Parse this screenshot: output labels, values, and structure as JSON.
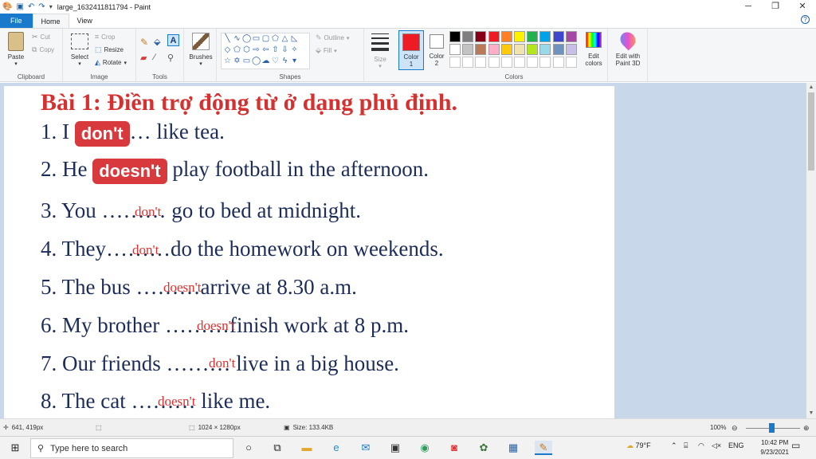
{
  "window": {
    "title": "large_1632411811794 - Paint",
    "qa_icons": [
      "paint-icon",
      "save-icon",
      "undo-icon",
      "redo-icon",
      "customize-icon"
    ]
  },
  "tabs": [
    {
      "label": "File"
    },
    {
      "label": "Home"
    },
    {
      "label": "View"
    }
  ],
  "ribbon": {
    "clipboard": {
      "name": "Clipboard",
      "paste": "Paste",
      "cut": "Cut",
      "copy": "Copy"
    },
    "image": {
      "name": "Image",
      "select": "Select",
      "crop": "Crop",
      "resize": "Resize",
      "rotate": "Rotate"
    },
    "tools": {
      "name": "Tools"
    },
    "brushes": {
      "label": "Brushes"
    },
    "shapes": {
      "name": "Shapes",
      "outline": "Outline",
      "fill": "Fill"
    },
    "size": {
      "label": "Size"
    },
    "color1": {
      "label": "Color\n1",
      "l1": "Color",
      "l2": "1",
      "value": "#ed1c24"
    },
    "color2": {
      "l1": "Color",
      "l2": "2",
      "value": "#ffffff"
    },
    "colors": {
      "name": "Colors",
      "row1": [
        "#000000",
        "#7f7f7f",
        "#880015",
        "#ed1c24",
        "#ff7f27",
        "#fff200",
        "#22b14c",
        "#00a2e8",
        "#3f48cc",
        "#a349a4"
      ],
      "row2": [
        "#ffffff",
        "#c3c3c3",
        "#b97a57",
        "#ffaec9",
        "#ffc90e",
        "#efe4b0",
        "#b5e61d",
        "#99d9ea",
        "#7092be",
        "#c8bfe7"
      ],
      "row3": [
        "#ffffff",
        "#ffffff",
        "#ffffff",
        "#ffffff",
        "#ffffff",
        "#ffffff",
        "#ffffff",
        "#ffffff",
        "#ffffff",
        "#ffffff"
      ]
    },
    "edit_colors": {
      "l1": "Edit",
      "l2": "colors"
    },
    "paint3d": {
      "l1": "Edit with",
      "l2": "Paint 3D"
    }
  },
  "document": {
    "title": "Bài 1: Điền trợ động từ ở dạng phủ định.",
    "lines": [
      {
        "pre": "1. I ",
        "highlight": "don't",
        "post": "… like tea."
      },
      {
        "pre": "2. He ",
        "highlight": "doesn't",
        "post": " play football in the afternoon."
      },
      {
        "text": "3. You ……… go to bed at midnight.",
        "answer": "don't"
      },
      {
        "text": "4. They………do the homework on weekends.",
        "answer": "don't"
      },
      {
        "text": "5. The bus ………arrive at 8.30 a.m.",
        "answer": "doesn't"
      },
      {
        "text": "6. My brother ………finish work at 8 p.m.",
        "answer": "doesn't"
      },
      {
        "text": "7. Our friends ……… live in a big house.",
        "answer": "don't"
      },
      {
        "text": "8. The cat ……… like me.",
        "answer": "doesn't"
      }
    ]
  },
  "status": {
    "cursor": "641, 419px",
    "dimensions": "1024 × 1280px",
    "size": "Size: 133.4KB",
    "zoom": "100%"
  },
  "taskbar": {
    "search_placeholder": "Type here to search",
    "weather": "79°F",
    "language": "ENG",
    "time": "10:42 PM",
    "date": "9/23/2021"
  }
}
